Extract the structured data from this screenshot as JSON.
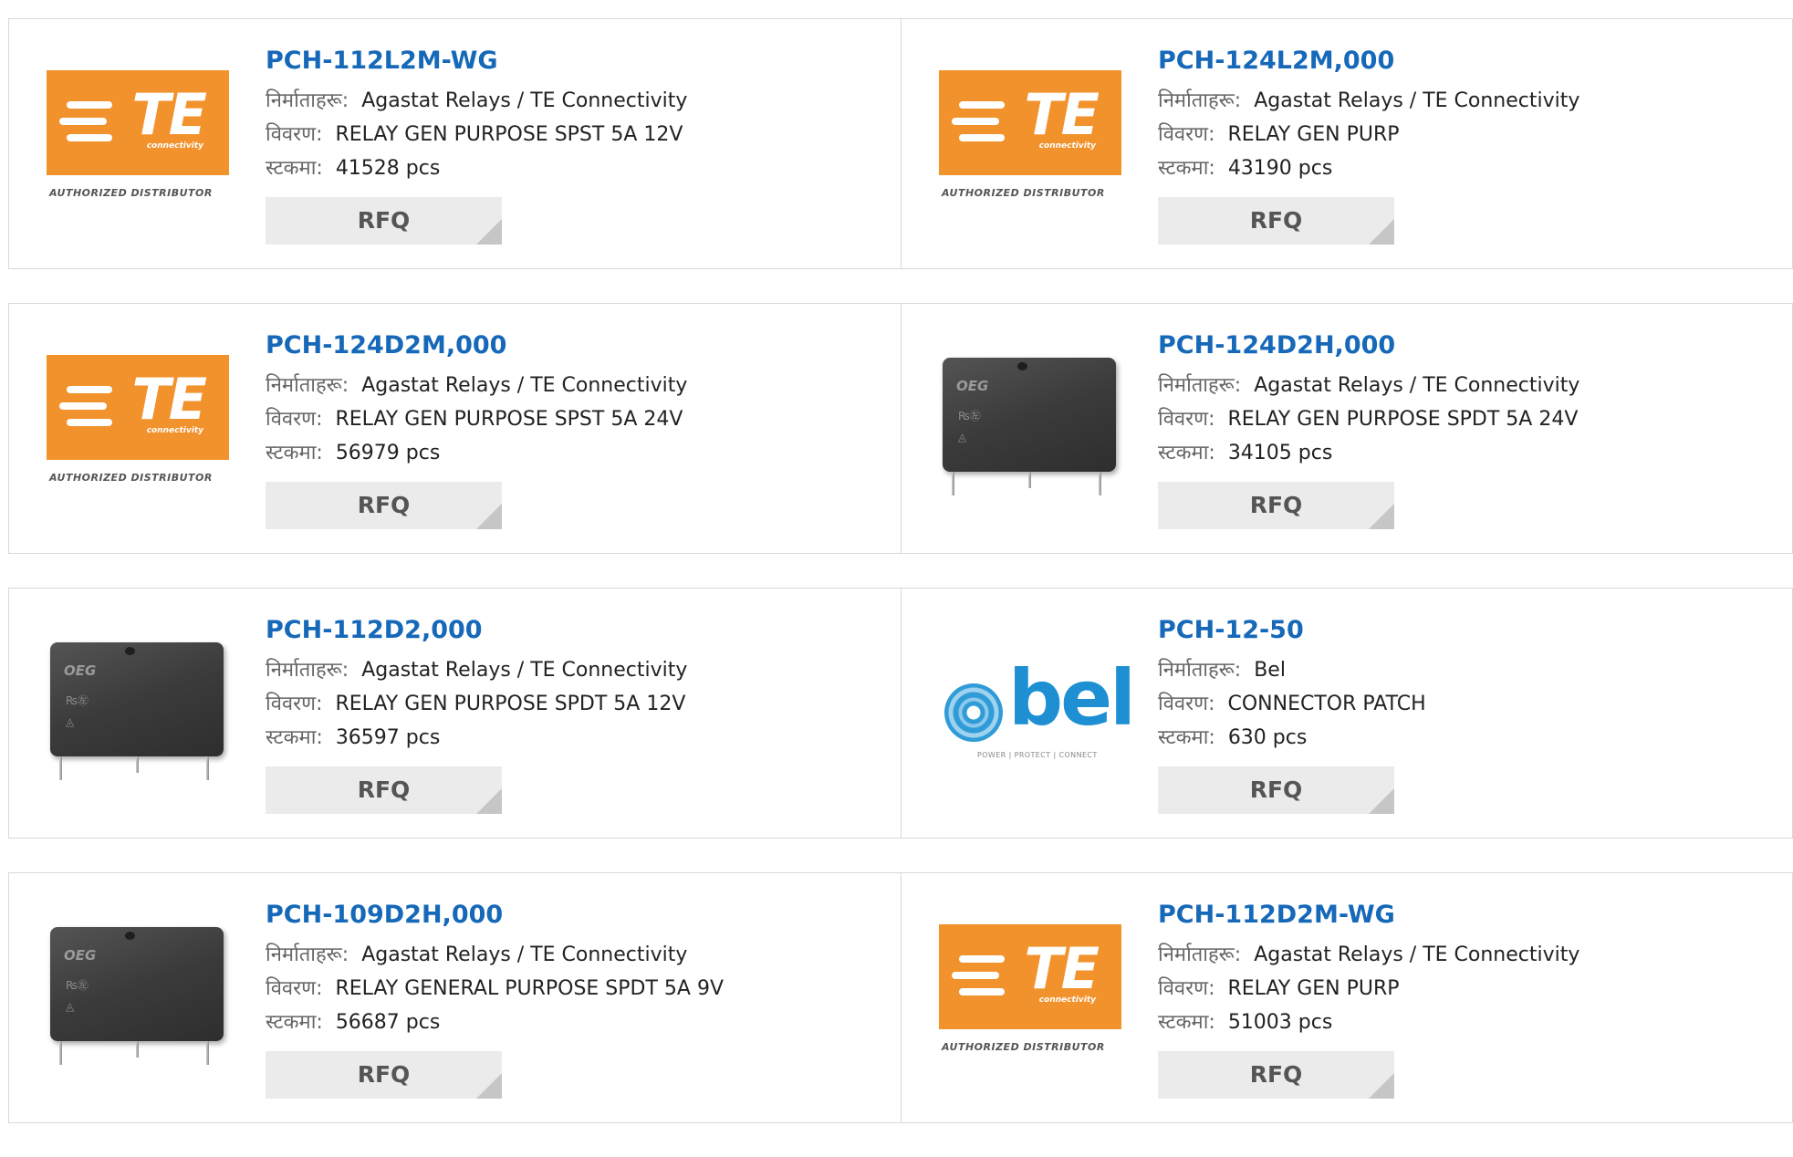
{
  "labels": {
    "manufacturer": "निर्माताहरू:",
    "description": "विवरण:",
    "stock": "स्टकमा:",
    "rfq": "RFQ"
  },
  "logos": {
    "te": {
      "text": "TE",
      "sub": "connectivity",
      "authorized": "AUTHORIZED DISTRIBUTOR",
      "color": "#f2922c"
    },
    "relay": {
      "brand": "OEG",
      "mark": "₨㊧",
      "cert": "◬"
    },
    "bel": {
      "text": "bel",
      "tagline": "POWER | PROTECT | CONNECT",
      "color": "#1d8fd2"
    }
  },
  "colors": {
    "title": "#1668b8",
    "rfq_bg": "#ebebeb"
  },
  "products": [
    {
      "part": "PCH-112L2M-WG",
      "image": "te-logo",
      "manufacturer": "Agastat Relays / TE Connectivity",
      "description": "RELAY GEN PURPOSE SPST 5A 12V",
      "stock": "41528 pcs"
    },
    {
      "part": "PCH-124L2M,000",
      "image": "te-logo",
      "manufacturer": "Agastat Relays / TE Connectivity",
      "description": "RELAY GEN PURP",
      "stock": "43190 pcs"
    },
    {
      "part": "PCH-124D2M,000",
      "image": "te-logo",
      "manufacturer": "Agastat Relays / TE Connectivity",
      "description": "RELAY GEN PURPOSE SPST 5A 24V",
      "stock": "56979 pcs"
    },
    {
      "part": "PCH-124D2H,000",
      "image": "relay-photo",
      "manufacturer": "Agastat Relays / TE Connectivity",
      "description": "RELAY GEN PURPOSE SPDT 5A 24V",
      "stock": "34105 pcs"
    },
    {
      "part": "PCH-112D2,000",
      "image": "relay-photo",
      "manufacturer": "Agastat Relays / TE Connectivity",
      "description": "RELAY GEN PURPOSE SPDT 5A 12V",
      "stock": "36597 pcs"
    },
    {
      "part": "PCH-12-50",
      "image": "bel-logo",
      "manufacturer": "Bel",
      "description": "CONNECTOR PATCH",
      "stock": "630 pcs"
    },
    {
      "part": "PCH-109D2H,000",
      "image": "relay-photo",
      "manufacturer": "Agastat Relays / TE Connectivity",
      "description": "RELAY GENERAL PURPOSE SPDT 5A 9V",
      "stock": "56687 pcs"
    },
    {
      "part": "PCH-112D2M-WG",
      "image": "te-logo",
      "manufacturer": "Agastat Relays / TE Connectivity",
      "description": "RELAY GEN PURP",
      "stock": "51003 pcs"
    }
  ]
}
